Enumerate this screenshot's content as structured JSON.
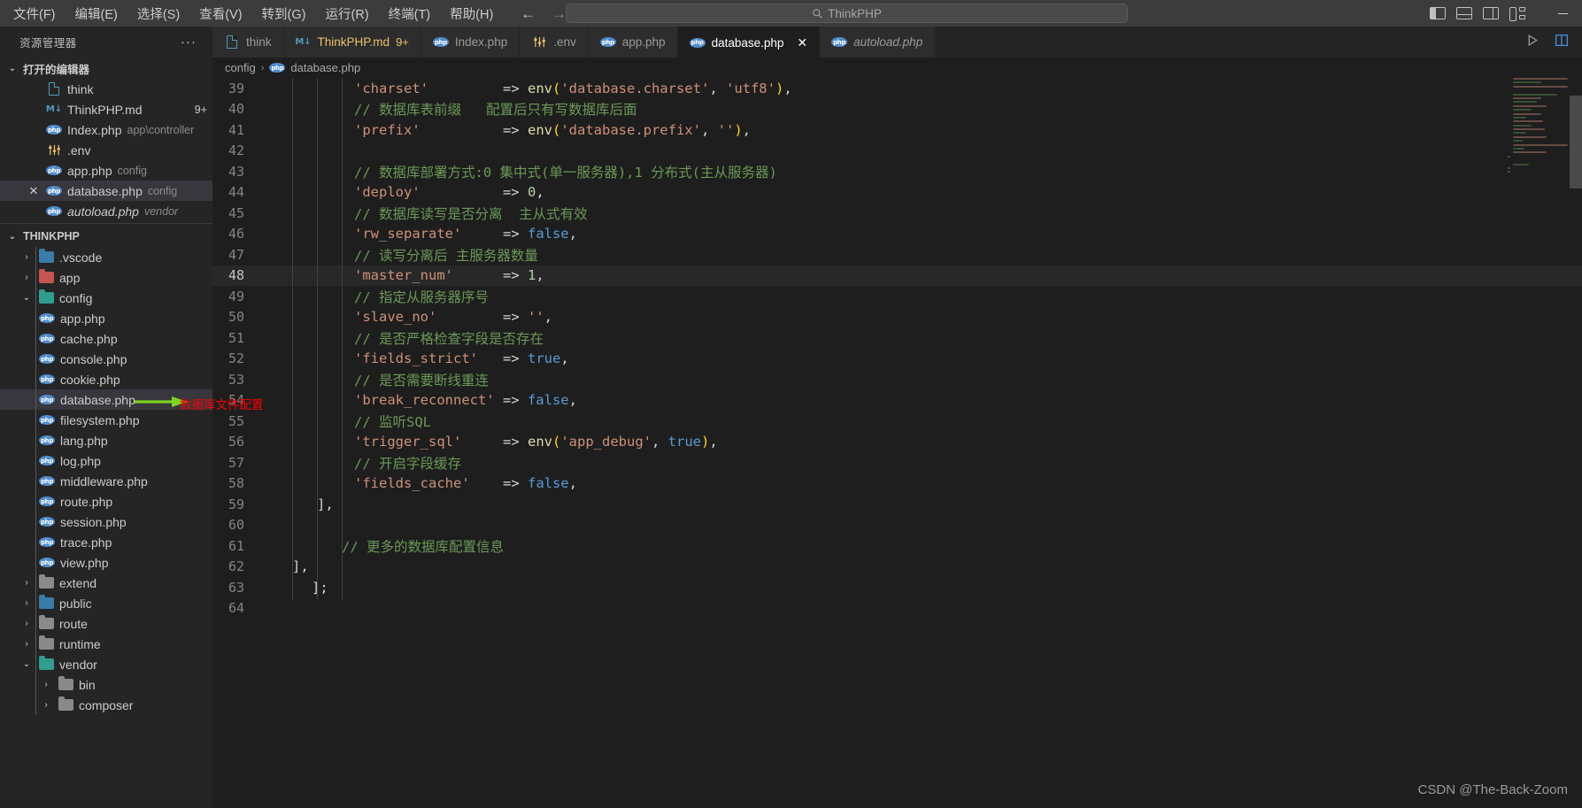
{
  "titlebar": {
    "menus": [
      "文件(F)",
      "编辑(E)",
      "选择(S)",
      "查看(V)",
      "转到(G)",
      "运行(R)",
      "终端(T)",
      "帮助(H)"
    ],
    "nav_back": "←",
    "nav_forward": "→",
    "search_value": "ThinkPHP",
    "search_icon": "search-icon",
    "layout_icons": [
      "toggle-primary-sidebar-icon",
      "toggle-panel-icon",
      "toggle-secondary-sidebar-icon",
      "customize-layout-icon"
    ],
    "minimize": "—"
  },
  "sidebar": {
    "title": "资源管理器",
    "more_actions": "···",
    "open_editors": {
      "label": "打开的编辑器",
      "twisty": "⌄",
      "items": [
        {
          "label": "think",
          "desc": "",
          "icon": "file-icon",
          "badge": "",
          "selected": false,
          "preview": false,
          "close": false
        },
        {
          "label": "ThinkPHP.md",
          "desc": "",
          "icon": "markdown-icon",
          "badge": "9+",
          "selected": false,
          "preview": false,
          "close": false
        },
        {
          "label": "Index.php",
          "desc": "app\\controller",
          "icon": "php-icon",
          "badge": "",
          "selected": false,
          "preview": false,
          "close": false
        },
        {
          "label": ".env",
          "desc": "",
          "icon": "env-icon",
          "badge": "",
          "selected": false,
          "preview": false,
          "close": false
        },
        {
          "label": "app.php",
          "desc": "config",
          "icon": "php-icon",
          "badge": "",
          "selected": false,
          "preview": false,
          "close": false
        },
        {
          "label": "database.php",
          "desc": "config",
          "icon": "php-icon",
          "badge": "",
          "selected": true,
          "preview": false,
          "close": true
        },
        {
          "label": "autoload.php",
          "desc": "vendor",
          "icon": "php-icon",
          "badge": "",
          "selected": false,
          "preview": true,
          "close": false
        }
      ]
    },
    "workspace": {
      "label": "THINKPHP",
      "twisty": "⌄",
      "tree": [
        {
          "label": ".vscode",
          "type": "folder",
          "folder_color": "vscode",
          "expanded": false,
          "depth": 1
        },
        {
          "label": "app",
          "type": "folder",
          "folder_color": "app",
          "expanded": false,
          "depth": 1
        },
        {
          "label": "config",
          "type": "folder",
          "folder_color": "config",
          "expanded": true,
          "depth": 1
        },
        {
          "label": "app.php",
          "type": "file",
          "depth": 2
        },
        {
          "label": "cache.php",
          "type": "file",
          "depth": 2
        },
        {
          "label": "console.php",
          "type": "file",
          "depth": 2
        },
        {
          "label": "cookie.php",
          "type": "file",
          "depth": 2
        },
        {
          "label": "database.php",
          "type": "file",
          "depth": 2,
          "selected": true
        },
        {
          "label": "filesystem.php",
          "type": "file",
          "depth": 2
        },
        {
          "label": "lang.php",
          "type": "file",
          "depth": 2
        },
        {
          "label": "log.php",
          "type": "file",
          "depth": 2
        },
        {
          "label": "middleware.php",
          "type": "file",
          "depth": 2
        },
        {
          "label": "route.php",
          "type": "file",
          "depth": 2
        },
        {
          "label": "session.php",
          "type": "file",
          "depth": 2
        },
        {
          "label": "trace.php",
          "type": "file",
          "depth": 2
        },
        {
          "label": "view.php",
          "type": "file",
          "depth": 2
        },
        {
          "label": "extend",
          "type": "folder",
          "folder_color": "plain",
          "expanded": false,
          "depth": 1
        },
        {
          "label": "public",
          "type": "folder",
          "folder_color": "public",
          "expanded": false,
          "depth": 1
        },
        {
          "label": "route",
          "type": "folder",
          "folder_color": "plain",
          "expanded": false,
          "depth": 1
        },
        {
          "label": "runtime",
          "type": "folder",
          "folder_color": "runtime",
          "expanded": false,
          "depth": 1
        },
        {
          "label": "vendor",
          "type": "folder",
          "folder_color": "vendor",
          "expanded": true,
          "depth": 1
        },
        {
          "label": "bin",
          "type": "folder",
          "folder_color": "bin",
          "expanded": false,
          "depth": 2
        },
        {
          "label": "composer",
          "type": "folder",
          "folder_color": "bin",
          "expanded": false,
          "depth": 2
        }
      ]
    }
  },
  "tabs": [
    {
      "label": "think",
      "icon": "file-icon",
      "active": false,
      "preview": false,
      "badge": "",
      "close": false
    },
    {
      "label": "ThinkPHP.md",
      "icon": "markdown-icon",
      "active": false,
      "preview": false,
      "badge": "9+",
      "close": false
    },
    {
      "label": "Index.php",
      "icon": "php-icon",
      "active": false,
      "preview": false,
      "badge": "",
      "close": false
    },
    {
      "label": ".env",
      "icon": "env-icon",
      "active": false,
      "preview": false,
      "badge": "",
      "close": false
    },
    {
      "label": "app.php",
      "icon": "php-icon",
      "active": false,
      "preview": false,
      "badge": "",
      "close": false
    },
    {
      "label": "database.php",
      "icon": "php-icon",
      "active": true,
      "preview": false,
      "badge": "",
      "close": true
    },
    {
      "label": "autoload.php",
      "icon": "php-icon",
      "active": false,
      "preview": true,
      "badge": "",
      "close": false
    }
  ],
  "tab_actions": [
    "run-icon",
    "split-editor-icon"
  ],
  "breadcrumb": {
    "folder": "config",
    "separator": "›",
    "file": "database.php"
  },
  "editor": {
    "current_line": 48,
    "lines": [
      {
        "n": 39,
        "tokens": [
          {
            "t": "'charset'",
            "c": "str"
          },
          {
            "t": "         => ",
            "c": "op"
          },
          {
            "t": "env",
            "c": "fn"
          },
          {
            "t": "(",
            "c": "paren"
          },
          {
            "t": "'database.charset'",
            "c": "str"
          },
          {
            "t": ", ",
            "c": "op"
          },
          {
            "t": "'utf8'",
            "c": "str"
          },
          {
            "t": ")",
            "c": "paren"
          },
          {
            "t": ",",
            "c": "op"
          }
        ]
      },
      {
        "n": 40,
        "tokens": [
          {
            "t": "// 数据库表前缀   配置后只有写数据库后面",
            "c": "cmt"
          }
        ]
      },
      {
        "n": 41,
        "tokens": [
          {
            "t": "'prefix'",
            "c": "str"
          },
          {
            "t": "          => ",
            "c": "op"
          },
          {
            "t": "env",
            "c": "fn"
          },
          {
            "t": "(",
            "c": "paren"
          },
          {
            "t": "'database.prefix'",
            "c": "str"
          },
          {
            "t": ", ",
            "c": "op"
          },
          {
            "t": "''",
            "c": "str"
          },
          {
            "t": ")",
            "c": "paren"
          },
          {
            "t": ",",
            "c": "op"
          }
        ]
      },
      {
        "n": 42,
        "tokens": []
      },
      {
        "n": 43,
        "tokens": [
          {
            "t": "// 数据库部署方式:0 集中式(单一服务器),1 分布式(主从服务器)",
            "c": "cmt"
          }
        ]
      },
      {
        "n": 44,
        "tokens": [
          {
            "t": "'deploy'",
            "c": "str"
          },
          {
            "t": "          => ",
            "c": "op"
          },
          {
            "t": "0",
            "c": "num"
          },
          {
            "t": ",",
            "c": "op"
          }
        ]
      },
      {
        "n": 45,
        "tokens": [
          {
            "t": "// 数据库读写是否分离  主从式有效",
            "c": "cmt"
          }
        ]
      },
      {
        "n": 46,
        "tokens": [
          {
            "t": "'rw_separate'",
            "c": "str"
          },
          {
            "t": "     => ",
            "c": "op"
          },
          {
            "t": "false",
            "c": "kw"
          },
          {
            "t": ",",
            "c": "op"
          }
        ]
      },
      {
        "n": 47,
        "tokens": [
          {
            "t": "// 读写分离后 主服务器数量",
            "c": "cmt"
          }
        ]
      },
      {
        "n": 48,
        "tokens": [
          {
            "t": "'master_num'",
            "c": "str"
          },
          {
            "t": "      => ",
            "c": "op"
          },
          {
            "t": "1",
            "c": "num"
          },
          {
            "t": ",",
            "c": "op"
          }
        ]
      },
      {
        "n": 49,
        "tokens": [
          {
            "t": "// 指定从服务器序号",
            "c": "cmt"
          }
        ]
      },
      {
        "n": 50,
        "tokens": [
          {
            "t": "'slave_no'",
            "c": "str"
          },
          {
            "t": "        => ",
            "c": "op"
          },
          {
            "t": "''",
            "c": "str"
          },
          {
            "t": ",",
            "c": "op"
          }
        ]
      },
      {
        "n": 51,
        "tokens": [
          {
            "t": "// 是否严格检查字段是否存在",
            "c": "cmt"
          }
        ]
      },
      {
        "n": 52,
        "tokens": [
          {
            "t": "'fields_strict'",
            "c": "str"
          },
          {
            "t": "   => ",
            "c": "op"
          },
          {
            "t": "true",
            "c": "kw"
          },
          {
            "t": ",",
            "c": "op"
          }
        ]
      },
      {
        "n": 53,
        "tokens": [
          {
            "t": "// 是否需要断线重连",
            "c": "cmt"
          }
        ]
      },
      {
        "n": 54,
        "tokens": [
          {
            "t": "'break_reconnect'",
            "c": "str"
          },
          {
            "t": " => ",
            "c": "op"
          },
          {
            "t": "false",
            "c": "kw"
          },
          {
            "t": ",",
            "c": "op"
          }
        ]
      },
      {
        "n": 55,
        "tokens": [
          {
            "t": "// 监听SQL",
            "c": "cmt"
          }
        ]
      },
      {
        "n": 56,
        "tokens": [
          {
            "t": "'trigger_sql'",
            "c": "str"
          },
          {
            "t": "     => ",
            "c": "op"
          },
          {
            "t": "env",
            "c": "fn"
          },
          {
            "t": "(",
            "c": "paren"
          },
          {
            "t": "'app_debug'",
            "c": "str"
          },
          {
            "t": ", ",
            "c": "op"
          },
          {
            "t": "true",
            "c": "kw"
          },
          {
            "t": ")",
            "c": "paren"
          },
          {
            "t": ",",
            "c": "op"
          }
        ]
      },
      {
        "n": 57,
        "tokens": [
          {
            "t": "// 开启字段缓存",
            "c": "cmt"
          }
        ]
      },
      {
        "n": 58,
        "tokens": [
          {
            "t": "'fields_cache'",
            "c": "str"
          },
          {
            "t": "    => ",
            "c": "op"
          },
          {
            "t": "false",
            "c": "kw"
          },
          {
            "t": ",",
            "c": "op"
          }
        ]
      },
      {
        "n": 59,
        "tokens": [
          {
            "t": "],",
            "c": "punc"
          }
        ],
        "indent": 1
      },
      {
        "n": 60,
        "tokens": []
      },
      {
        "n": 61,
        "tokens": [
          {
            "t": "// 更多的数据库配置信息",
            "c": "cmt"
          }
        ],
        "indent": 2
      },
      {
        "n": 62,
        "tokens": [
          {
            "t": "],",
            "c": "punc"
          }
        ],
        "indent": 0
      },
      {
        "n": 63,
        "tokens": [
          {
            "t": "];",
            "c": "punc"
          }
        ],
        "indent": -1
      },
      {
        "n": 64,
        "tokens": []
      }
    ]
  },
  "annotation": {
    "text": "数据库文件配置",
    "arrow_color": "#7dd321",
    "text_color": "#ff0000"
  },
  "watermark": "CSDN @The-Back-Zoom"
}
